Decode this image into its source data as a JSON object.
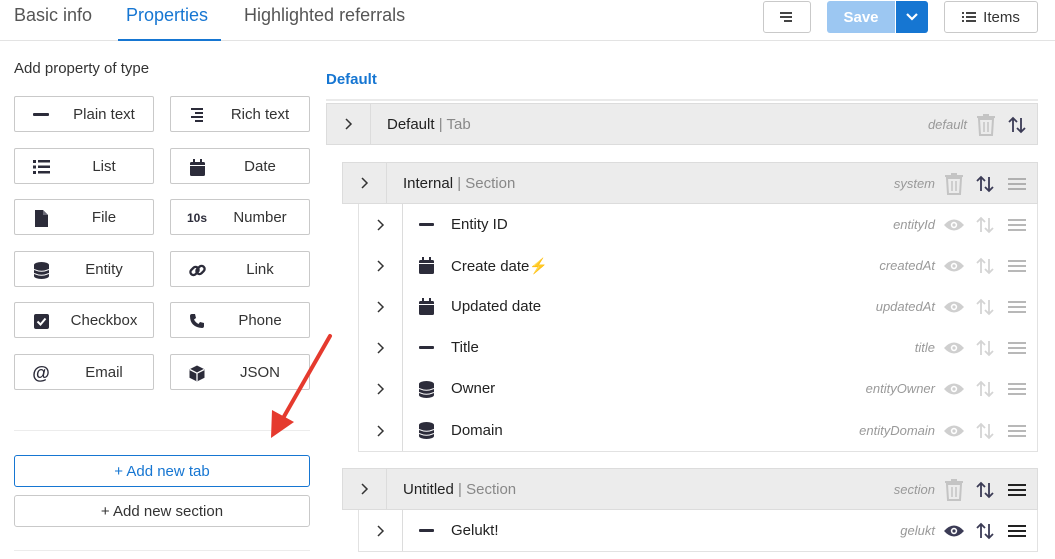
{
  "topbar": {
    "tabs": [
      {
        "label": "Basic info",
        "active": false
      },
      {
        "label": "Properties",
        "active": true
      },
      {
        "label": "Highlighted referrals",
        "active": false
      }
    ],
    "save_label": "Save",
    "items_label": "Items",
    "accent_color": "#1676d2",
    "save_color": "#9cc7f2"
  },
  "left": {
    "title": "Add property of type",
    "types": [
      {
        "label": "Plain text",
        "icon": "minus-icon"
      },
      {
        "label": "Rich text",
        "icon": "align-right-icon"
      },
      {
        "label": "List",
        "icon": "list-icon"
      },
      {
        "label": "Date",
        "icon": "calendar-icon"
      },
      {
        "label": "File",
        "icon": "file-icon"
      },
      {
        "label": "Number",
        "icon": "number-icon",
        "icon_text": "10s"
      },
      {
        "label": "Entity",
        "icon": "database-icon"
      },
      {
        "label": "Link",
        "icon": "link-icon"
      },
      {
        "label": "Checkbox",
        "icon": "checkbox-icon"
      },
      {
        "label": "Phone",
        "icon": "phone-icon"
      },
      {
        "label": "Email",
        "icon": "at-icon"
      },
      {
        "label": "JSON",
        "icon": "cube-icon"
      }
    ],
    "add_tab": "+ Add new tab",
    "add_section": "+ Add new section"
  },
  "right": {
    "tab_label": "Default",
    "tab": {
      "name": "Default",
      "kind": "| Tab",
      "key": "default"
    },
    "sections": [
      {
        "name": "Internal",
        "kind": "| Section",
        "key": "system",
        "items": [
          {
            "name": "Entity ID",
            "key": "entityId",
            "icon": "minus-icon"
          },
          {
            "name": "Create date",
            "suffix": "⚡",
            "key": "createdAt",
            "icon": "calendar-icon"
          },
          {
            "name": "Updated date",
            "key": "updatedAt",
            "icon": "calendar-icon"
          },
          {
            "name": "Title",
            "key": "title",
            "icon": "minus-icon"
          },
          {
            "name": "Owner",
            "key": "entityOwner",
            "icon": "database-icon"
          },
          {
            "name": "Domain",
            "key": "entityDomain",
            "icon": "database-icon"
          }
        ]
      },
      {
        "name": "Untitled",
        "kind": "| Section",
        "key": "section",
        "items": [
          {
            "name": "Gelukt!",
            "key": "gelukt",
            "icon": "minus-icon"
          }
        ]
      }
    ]
  }
}
